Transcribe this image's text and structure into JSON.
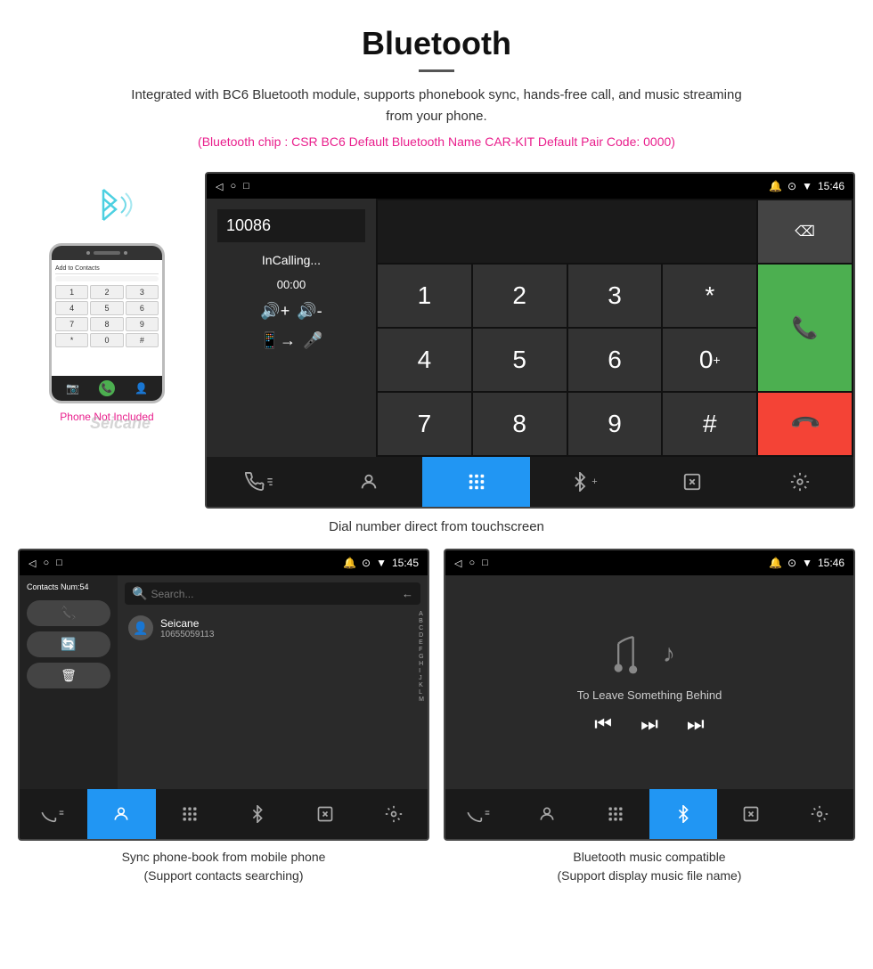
{
  "header": {
    "title": "Bluetooth",
    "description": "Integrated with BC6 Bluetooth module, supports phonebook sync, hands-free call, and music streaming from your phone.",
    "specs": "(Bluetooth chip : CSR BC6    Default Bluetooth Name CAR-KIT    Default Pair Code: 0000)"
  },
  "car_screen_main": {
    "status_bar": {
      "back": "◁",
      "circle": "○",
      "square": "□",
      "icons_right": "🔔 ⊙ ▼",
      "time": "15:46"
    },
    "number_display": "10086",
    "calling_status": "InCalling...",
    "calling_time": "00:00",
    "dial_keys": [
      {
        "label": "1",
        "type": "normal"
      },
      {
        "label": "2",
        "type": "normal"
      },
      {
        "label": "3",
        "type": "normal"
      },
      {
        "label": "*",
        "type": "normal"
      },
      {
        "label": "green_call",
        "type": "green"
      },
      {
        "label": "4",
        "type": "normal"
      },
      {
        "label": "5",
        "type": "normal"
      },
      {
        "label": "6",
        "type": "normal"
      },
      {
        "label": "0+",
        "type": "normal"
      },
      {
        "label": "red_call",
        "type": "red"
      },
      {
        "label": "7",
        "type": "normal"
      },
      {
        "label": "8",
        "type": "normal"
      },
      {
        "label": "9",
        "type": "normal"
      },
      {
        "label": "#",
        "type": "normal"
      },
      {
        "label": "",
        "type": "empty"
      }
    ],
    "bottom_nav": [
      {
        "icon": "📞",
        "label": "phone",
        "active": false
      },
      {
        "icon": "👤",
        "label": "contacts",
        "active": false
      },
      {
        "icon": "⠿",
        "label": "dialpad",
        "active": true
      },
      {
        "icon": "✳",
        "label": "bluetooth",
        "active": false
      },
      {
        "icon": "⊡",
        "label": "exit",
        "active": false
      },
      {
        "icon": "⚙",
        "label": "settings",
        "active": false
      }
    ]
  },
  "phone_mockup": {
    "contacts_header": "Add to Contacts",
    "dial_keys": [
      "1",
      "2",
      "3",
      "4",
      "5",
      "6",
      "7",
      "8",
      "9",
      "*",
      "0",
      "#"
    ]
  },
  "phone_not_included": "Phone Not Included",
  "seicane_watermark": "Seicane",
  "main_caption": "Dial number direct from touchscreen",
  "contacts_screen": {
    "status_bar_time": "15:45",
    "contacts_num": "Contacts Num:54",
    "contact_name": "Seicane",
    "contact_phone": "10655059113",
    "alpha": [
      "A",
      "B",
      "C",
      "D",
      "E",
      "F",
      "G",
      "H",
      "I",
      "J",
      "K",
      "L",
      "M"
    ],
    "bottom_nav_active": "contacts"
  },
  "music_screen": {
    "status_bar_time": "15:46",
    "song_title": "To Leave Something Behind",
    "bottom_nav_active": "bluetooth"
  },
  "bottom_captions": {
    "left_main": "Sync phone-book from mobile phone",
    "left_sub": "(Support contacts searching)",
    "right_main": "Bluetooth music compatible",
    "right_sub": "(Support display music file name)"
  }
}
